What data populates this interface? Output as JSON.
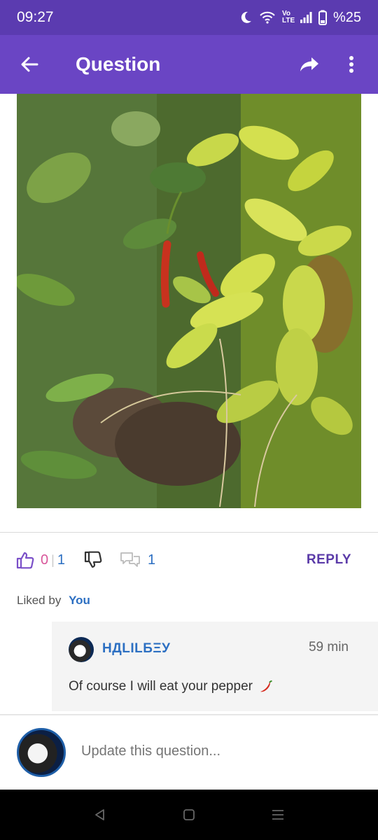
{
  "status": {
    "time": "09:27",
    "network": "Vo LTE",
    "battery": "%25",
    "icons": [
      "moon-icon",
      "wifi-icon",
      "signal-icon",
      "battery-icon"
    ]
  },
  "app_bar": {
    "title": "Question",
    "back_icon": "arrow-left-icon",
    "share_icon": "share-icon",
    "more_icon": "more-vertical-icon"
  },
  "post": {
    "image_subject": "chili pepper plant",
    "likes": "0",
    "like_total": "1",
    "comments": "1",
    "reply_label": "REPLY",
    "liked_by_label": "Liked by",
    "liked_by_user": "You"
  },
  "comment": {
    "username": "НДLILБΞУ",
    "time": "59 min",
    "text": "Of course I will eat your pepper"
  },
  "compose": {
    "placeholder": "Update this question..."
  },
  "colors": {
    "status_bar": "#5b3bb0",
    "app_bar": "#6a45c4",
    "accent_blue": "#2c6fc2",
    "reply_purple": "#5a3aa8",
    "like_pink": "#d8569a"
  }
}
